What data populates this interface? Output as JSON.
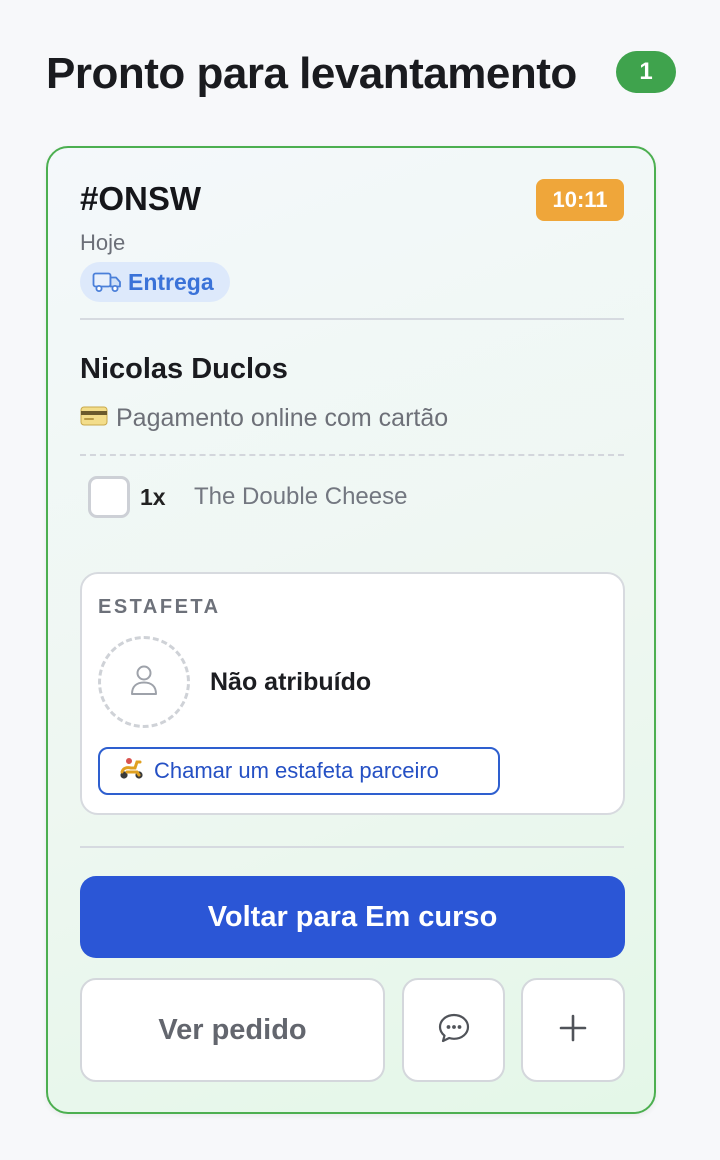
{
  "header": {
    "title": "Pronto para levantamento",
    "count": "1"
  },
  "order": {
    "id": "#ONSW",
    "time": "10:11",
    "date": "Hoje",
    "type_label": "Entrega",
    "type_icon": "truck-icon",
    "customer_name": "Nicolas Duclos",
    "payment": {
      "icon": "credit-card-icon",
      "label": "Pagamento online com cartão"
    },
    "items": [
      {
        "checked": false,
        "qty": "1x",
        "name": "The Double Cheese"
      }
    ]
  },
  "courier": {
    "section_label": "ESTAFETA",
    "status": "Não atribuído",
    "avatar_icon": "user-icon",
    "partner_button": {
      "icon": "scooter-icon",
      "label": "Chamar um estafeta parceiro"
    }
  },
  "actions": {
    "primary": "Voltar para Em curso",
    "view_order": "Ver pedido",
    "chat_icon": "chat-bubble-icon",
    "more_icon": "plus-icon"
  },
  "colors": {
    "accent_green": "#3fa34d",
    "card_border": "#4caf50",
    "time_badge": "#efa63a",
    "primary_button": "#2b56d6",
    "chip_bg": "#dde9fb",
    "chip_text": "#3a72d8"
  }
}
